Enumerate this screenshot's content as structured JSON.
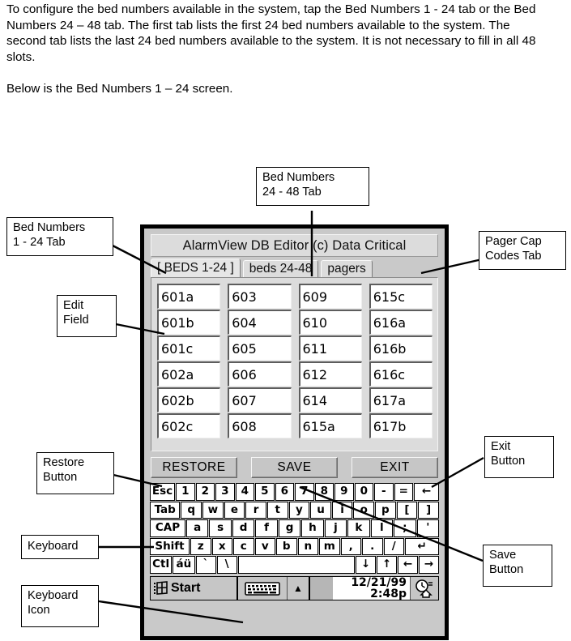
{
  "prose": {
    "paragraph1": "To configure the bed numbers available in the system, tap the Bed Numbers 1 - 24 tab or the Bed Numbers 24 – 48 tab.  The first tab lists the first 24 bed numbers available to the system.  The second tab lists the last 24 bed numbers available to the system.  It is not necessary to fill in all 48 slots.",
    "paragraph2": "Below is the Bed Numbers 1 – 24 screen."
  },
  "callouts": {
    "bed_1_24_tab": "Bed Numbers\n1 - 24 Tab",
    "bed_24_48_tab": "Bed Numbers\n24 - 48 Tab",
    "pager_cap_codes_tab": "Pager Cap\nCodes Tab",
    "edit_field": "Edit\nField",
    "restore_button": "Restore\nButton",
    "exit_button": "Exit\nButton",
    "save_button": "Save\nButton",
    "keyboard": "Keyboard",
    "keyboard_icon": "Keyboard\nIcon"
  },
  "device": {
    "titlebar": "AlarmView DB Editor (c) Data Critical",
    "tabs": [
      {
        "label": "[ BEDS 1-24 ]",
        "selected": true
      },
      {
        "label": "beds 24-48",
        "selected": false
      },
      {
        "label": "pagers",
        "selected": false
      }
    ],
    "bed_columns": [
      [
        "601a",
        "601b",
        "601c",
        "602a",
        "602b",
        "602c"
      ],
      [
        "603",
        "604",
        "605",
        "606",
        "607",
        "608"
      ],
      [
        "609",
        "610",
        "611",
        "612",
        "614",
        "615a"
      ],
      [
        "615c",
        "616a",
        "616b",
        "616c",
        "617a",
        "617b"
      ]
    ],
    "buttons": [
      {
        "label": "RESTORE",
        "name": "restore-button"
      },
      {
        "label": "SAVE",
        "name": "save-button"
      },
      {
        "label": "EXIT",
        "name": "exit-button"
      }
    ],
    "keyboard_rows": [
      [
        {
          "k": "Esc",
          "w": "w-esc"
        },
        {
          "k": "1"
        },
        {
          "k": "2"
        },
        {
          "k": "3"
        },
        {
          "k": "4"
        },
        {
          "k": "5"
        },
        {
          "k": "6"
        },
        {
          "k": "7"
        },
        {
          "k": "8"
        },
        {
          "k": "9"
        },
        {
          "k": "0"
        },
        {
          "k": "-"
        },
        {
          "k": "="
        },
        {
          "k": "←",
          "w": "w-bk"
        }
      ],
      [
        {
          "k": "Tab",
          "w": "w-tab"
        },
        {
          "k": "q"
        },
        {
          "k": "w"
        },
        {
          "k": "e"
        },
        {
          "k": "r"
        },
        {
          "k": "t"
        },
        {
          "k": "y"
        },
        {
          "k": "u"
        },
        {
          "k": "i"
        },
        {
          "k": "o"
        },
        {
          "k": "p"
        },
        {
          "k": "["
        },
        {
          "k": "]"
        }
      ],
      [
        {
          "k": "CAP",
          "w": "w-cap"
        },
        {
          "k": "a"
        },
        {
          "k": "s"
        },
        {
          "k": "d"
        },
        {
          "k": "f"
        },
        {
          "k": "g"
        },
        {
          "k": "h"
        },
        {
          "k": "j"
        },
        {
          "k": "k"
        },
        {
          "k": "l"
        },
        {
          "k": ";"
        },
        {
          "k": "'"
        }
      ],
      [
        {
          "k": "Shift",
          "w": "w-shift"
        },
        {
          "k": "z"
        },
        {
          "k": "x"
        },
        {
          "k": "c"
        },
        {
          "k": "v"
        },
        {
          "k": "b"
        },
        {
          "k": "n"
        },
        {
          "k": "m"
        },
        {
          "k": ","
        },
        {
          "k": "."
        },
        {
          "k": "/"
        },
        {
          "k": "↵",
          "w": "w-ent"
        }
      ],
      [
        {
          "k": "Ctl",
          "w": "w-ctl"
        },
        {
          "k": "áü",
          "w": "w-au"
        },
        {
          "k": "`"
        },
        {
          "k": "\\"
        },
        {
          "k": "",
          "w": "w-space"
        },
        {
          "k": "↓"
        },
        {
          "k": "↑"
        },
        {
          "k": "←"
        },
        {
          "k": "→"
        }
      ]
    ],
    "taskbar": {
      "start_label": "Start",
      "date": "12/21/99",
      "time": "2:48p",
      "up_arrow": "▲"
    }
  }
}
